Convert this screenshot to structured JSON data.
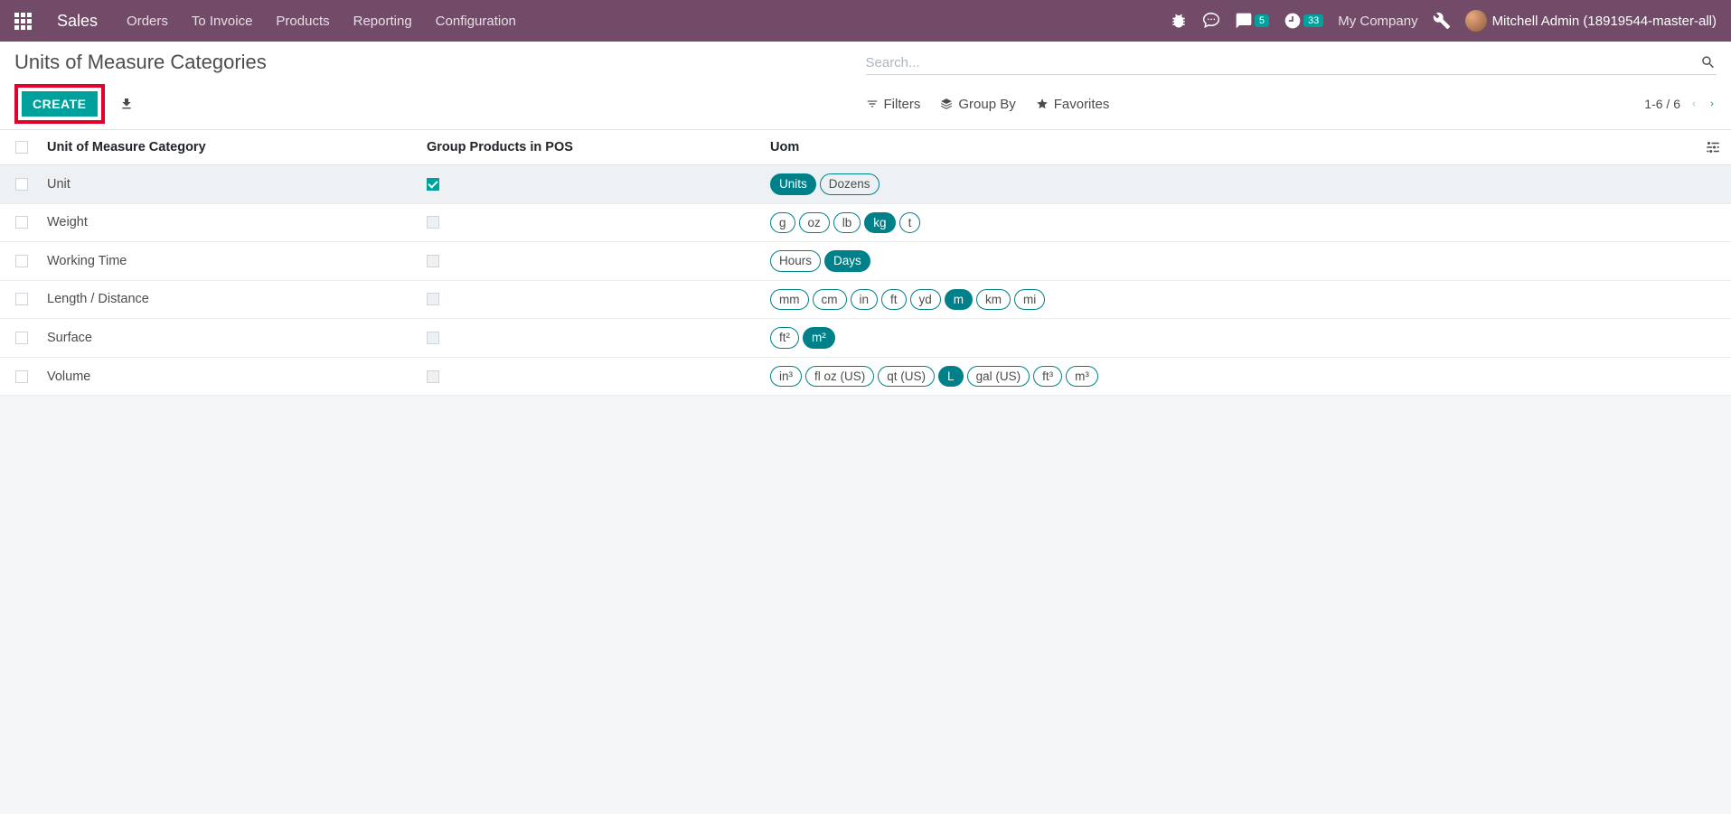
{
  "navbar": {
    "app": "Sales",
    "menu": [
      "Orders",
      "To Invoice",
      "Products",
      "Reporting",
      "Configuration"
    ],
    "messages_badge": "5",
    "activities_badge": "33",
    "company": "My Company",
    "user": "Mitchell Admin (18919544-master-all)"
  },
  "control": {
    "title": "Units of Measure Categories",
    "search_placeholder": "Search...",
    "create_label": "Create",
    "filters_label": "Filters",
    "groupby_label": "Group By",
    "favorites_label": "Favorites",
    "pager": "1-6 / 6"
  },
  "table": {
    "columns": {
      "category": "Unit of Measure Category",
      "pos": "Group Products in POS",
      "uom": "Uom"
    },
    "rows": [
      {
        "name": "Unit",
        "pos": true,
        "tags": [
          {
            "l": "Units",
            "a": true
          },
          {
            "l": "Dozens",
            "a": false
          }
        ],
        "active": true
      },
      {
        "name": "Weight",
        "pos": false,
        "tags": [
          {
            "l": "g",
            "a": false
          },
          {
            "l": "oz",
            "a": false
          },
          {
            "l": "lb",
            "a": false
          },
          {
            "l": "kg",
            "a": true
          },
          {
            "l": "t",
            "a": false
          }
        ]
      },
      {
        "name": "Working Time",
        "pos": false,
        "tags": [
          {
            "l": "Hours",
            "a": false
          },
          {
            "l": "Days",
            "a": true
          }
        ]
      },
      {
        "name": "Length / Distance",
        "pos": false,
        "tags": [
          {
            "l": "mm",
            "a": false
          },
          {
            "l": "cm",
            "a": false
          },
          {
            "l": "in",
            "a": false
          },
          {
            "l": "ft",
            "a": false
          },
          {
            "l": "yd",
            "a": false
          },
          {
            "l": "m",
            "a": true
          },
          {
            "l": "km",
            "a": false
          },
          {
            "l": "mi",
            "a": false
          }
        ]
      },
      {
        "name": "Surface",
        "pos": false,
        "tags": [
          {
            "l": "ft²",
            "a": false
          },
          {
            "l": "m²",
            "a": true
          }
        ]
      },
      {
        "name": "Volume",
        "pos": false,
        "tags": [
          {
            "l": "in³",
            "a": false
          },
          {
            "l": "fl oz (US)",
            "a": false
          },
          {
            "l": "qt (US)",
            "a": false
          },
          {
            "l": "L",
            "a": true
          },
          {
            "l": "gal (US)",
            "a": false
          },
          {
            "l": "ft³",
            "a": false
          },
          {
            "l": "m³",
            "a": false
          }
        ]
      }
    ]
  }
}
